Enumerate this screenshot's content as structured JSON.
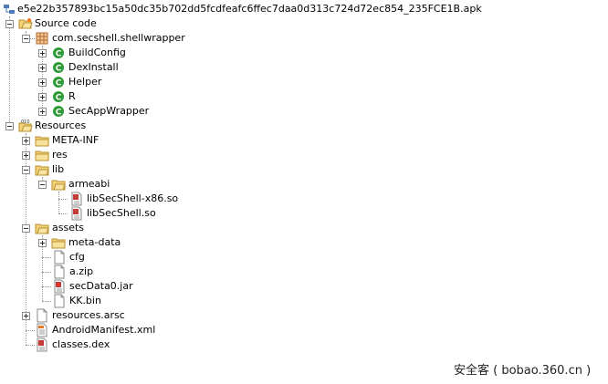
{
  "tree": {
    "root": {
      "label": "e5e22b357893bc15a50dc35b702dd5fcdfeafc6ffec7daa0d313c724d72ec854_235FCE1B.apk",
      "icon": "apk-icon"
    },
    "source_code": {
      "label": "Source code",
      "icon": "source-folder-icon"
    },
    "package": {
      "label": "com.secshell.shellwrapper",
      "icon": "package-icon"
    },
    "classes": [
      {
        "label": "BuildConfig",
        "icon": "class-icon"
      },
      {
        "label": "DexInstall",
        "icon": "class-icon"
      },
      {
        "label": "Helper",
        "icon": "class-icon"
      },
      {
        "label": "R",
        "icon": "class-icon"
      },
      {
        "label": "SecAppWrapper",
        "icon": "class-icon"
      }
    ],
    "resources": {
      "label": "Resources",
      "icon": "resources-folder-icon"
    },
    "meta_inf": {
      "label": "META-INF",
      "icon": "folder-icon"
    },
    "res": {
      "label": "res",
      "icon": "folder-icon"
    },
    "lib": {
      "label": "lib",
      "icon": "folder-icon"
    },
    "armeabi": {
      "label": "armeabi",
      "icon": "folder-icon"
    },
    "so_files": [
      {
        "label": "libSecShell-x86.so",
        "icon": "binary-file-icon"
      },
      {
        "label": "libSecShell.so",
        "icon": "binary-file-icon"
      }
    ],
    "assets": {
      "label": "assets",
      "icon": "folder-icon"
    },
    "meta_data": {
      "label": "meta-data",
      "icon": "folder-icon"
    },
    "asset_files": [
      {
        "label": "cfg",
        "icon": "file-icon"
      },
      {
        "label": "a.zip",
        "icon": "file-icon"
      },
      {
        "label": "secData0.jar",
        "icon": "binary-file-icon"
      },
      {
        "label": "KK.bin",
        "icon": "file-icon"
      }
    ],
    "resources_arsc": {
      "label": "resources.arsc",
      "icon": "file-icon"
    },
    "manifest": {
      "label": "AndroidManifest.xml",
      "icon": "xml-file-icon"
    },
    "classes_dex": {
      "label": "classes.dex",
      "icon": "binary-file-icon"
    }
  },
  "watermark": "安全客 ( bobao.360.cn )",
  "colors": {
    "class_green": "#2e9a35",
    "folder_yellow": "#f3d27a",
    "binary_red": "#c83a3a"
  }
}
